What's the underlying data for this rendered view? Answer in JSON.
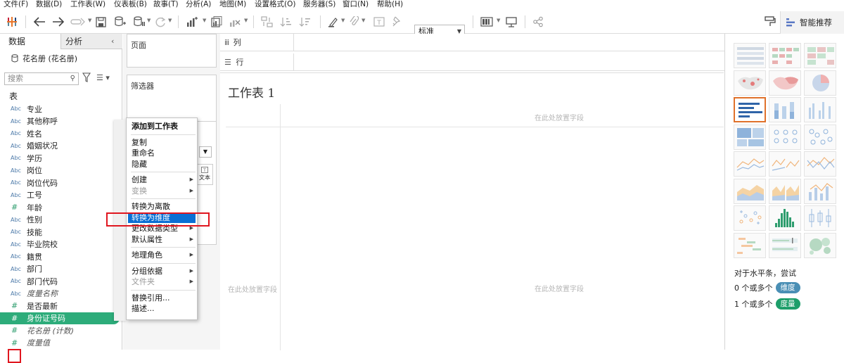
{
  "menubar": [
    "文件(F)",
    "数据(D)",
    "工作表(W)",
    "仪表板(B)",
    "故事(T)",
    "分析(A)",
    "地图(M)",
    "设置格式(O)",
    "服务器(S)",
    "窗口(N)",
    "帮助(H)"
  ],
  "toolbar": {
    "fit_select": "标准",
    "show_me_label": "智能推荐"
  },
  "data_pane": {
    "tab_data": "数据",
    "tab_analysis": "分析",
    "datasource": "花名册 (花名册)",
    "search_placeholder": "搜索",
    "tables_heading": "表",
    "fields": [
      {
        "type": "Abc",
        "name": "专业"
      },
      {
        "type": "Abc",
        "name": "其他称呼"
      },
      {
        "type": "Abc",
        "name": "姓名"
      },
      {
        "type": "Abc",
        "name": "婚姻状况"
      },
      {
        "type": "Abc",
        "name": "学历"
      },
      {
        "type": "Abc",
        "name": "岗位"
      },
      {
        "type": "Abc",
        "name": "岗位代码"
      },
      {
        "type": "Abc",
        "name": "工号"
      },
      {
        "type": "#",
        "name": "年龄"
      },
      {
        "type": "Abc",
        "name": "性别"
      },
      {
        "type": "Abc",
        "name": "技能"
      },
      {
        "type": "Abc",
        "name": "毕业院校"
      },
      {
        "type": "Abc",
        "name": "籍贯"
      },
      {
        "type": "Abc",
        "name": "部门"
      },
      {
        "type": "Abc",
        "name": "部门代码"
      },
      {
        "type": "Abc",
        "name": "度量名称"
      },
      {
        "type": "#",
        "name": "是否最新"
      },
      {
        "type": "#",
        "name": "身份证号码"
      },
      {
        "type": "=",
        "name": "花名册 (计数)"
      },
      {
        "type": "#",
        "name": "度量值"
      }
    ]
  },
  "shelves": {
    "pages": "页面",
    "filters": "筛选器",
    "columns": "列",
    "rows": "行",
    "marks_text_btn": "文本"
  },
  "worksheet": {
    "title": "工作表 1",
    "drop_hint": "在此处放置字段"
  },
  "context_menu": [
    {
      "label": "添加到工作表",
      "bold": true
    },
    {
      "sep": true
    },
    {
      "label": "复制"
    },
    {
      "label": "重命名"
    },
    {
      "label": "隐藏"
    },
    {
      "sep": true
    },
    {
      "label": "创建",
      "sub": true
    },
    {
      "label": "变换",
      "sub": true,
      "disabled": true
    },
    {
      "sep": true
    },
    {
      "label": "转换为离散"
    },
    {
      "label": "转换为维度",
      "highlight": true
    },
    {
      "label": "更改数据类型",
      "sub": true
    },
    {
      "label": "默认属性",
      "sub": true
    },
    {
      "sep": true
    },
    {
      "label": "地理角色",
      "sub": true
    },
    {
      "sep": true
    },
    {
      "label": "分组依据",
      "sub": true
    },
    {
      "label": "文件夹",
      "sub": true,
      "disabled": true
    },
    {
      "sep": true
    },
    {
      "label": "替换引用..."
    },
    {
      "label": "描述..."
    }
  ],
  "show_me": {
    "hint": "对于水平条，尝试",
    "row1_text": "0 个或多个",
    "row1_pill": "维度",
    "row2_text": "1 个或多个",
    "row2_pill": "度量"
  },
  "colors": {
    "dimension": "#4a8fb5",
    "measure": "#1e9e6a",
    "selected_field": "#2dac7a",
    "highlight": "#0a6fd4",
    "annotation_box": "#e0161f",
    "chart_selected_border": "#e0712b"
  }
}
